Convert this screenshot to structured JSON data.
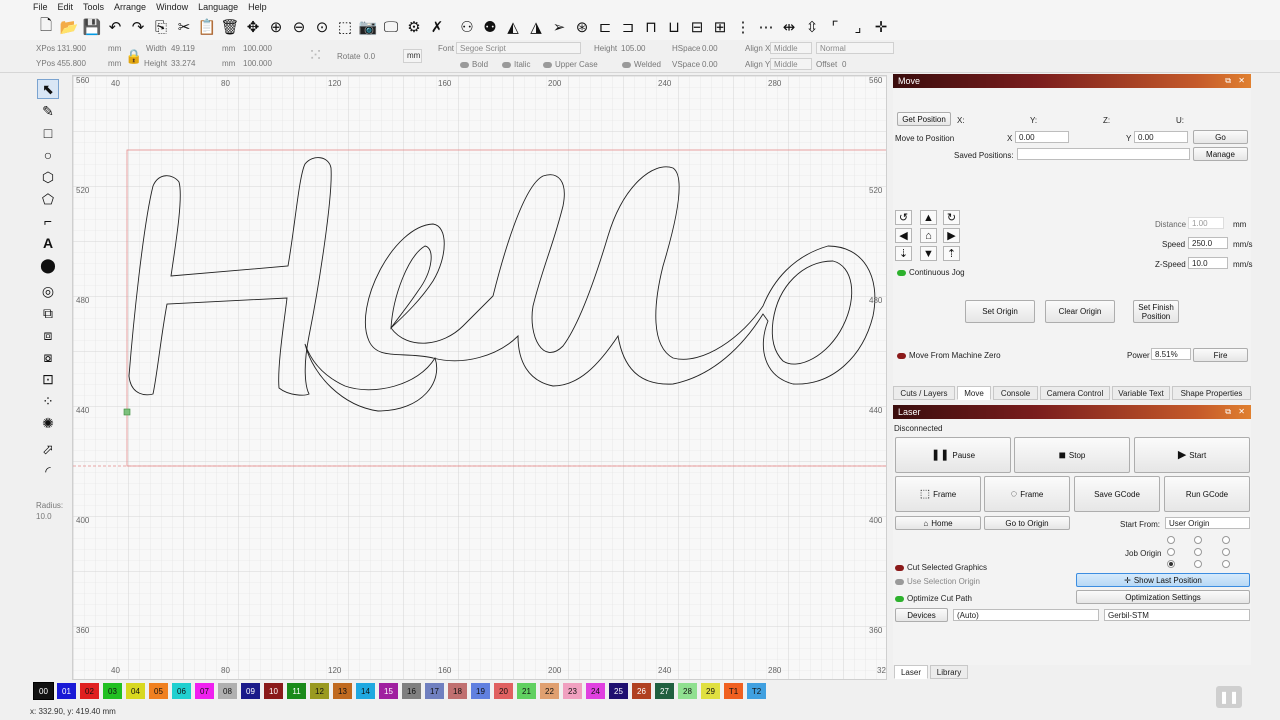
{
  "menu": [
    "File",
    "Edit",
    "Tools",
    "Arrange",
    "Window",
    "Language",
    "Help"
  ],
  "props": {
    "xpos_label": "XPos",
    "xpos": "131.900",
    "ypos_label": "YPos",
    "ypos": "455.800",
    "unit": "mm",
    "width_label": "Width",
    "width": "49.119",
    "height_label": "Height",
    "height": "33.274",
    "pct_w": "100.000",
    "pct_h": "100.000",
    "rotate_label": "Rotate",
    "rotate": "0.0",
    "mm_btn": "mm",
    "font_label": "Font",
    "font": "Segoe Script",
    "fheight_label": "Height",
    "fheight": "105.00",
    "hspace_label": "HSpace",
    "hspace": "0.00",
    "vspace_label": "VSpace",
    "vspace": "0.00",
    "alignx_label": "Align X",
    "alignx": "Middle",
    "aligny_label": "Align Y",
    "aligny": "Middle",
    "normal": "Normal",
    "offset_label": "Offset",
    "offset": "0",
    "bold": "Bold",
    "italic": "Italic",
    "upper": "Upper Case",
    "welded": "Welded"
  },
  "palette": {
    "radius_label": "Radius:",
    "radius": "10.0"
  },
  "ruler": {
    "x": [
      "40",
      "80",
      "120",
      "160",
      "200",
      "240",
      "280"
    ],
    "x_bottom": [
      "40",
      "80",
      "120",
      "160",
      "200",
      "240",
      "280",
      "32"
    ],
    "y": [
      "560",
      "520",
      "480",
      "440",
      "400",
      "360"
    ],
    "y_right": [
      "560",
      "520",
      "480",
      "440",
      "400",
      "360"
    ]
  },
  "colors": [
    {
      "label": "00",
      "color": "#111111"
    },
    {
      "label": "01",
      "color": "#1a1ad6"
    },
    {
      "label": "02",
      "color": "#e02020"
    },
    {
      "label": "03",
      "color": "#22c022"
    },
    {
      "label": "04",
      "color": "#d8d820"
    },
    {
      "label": "05",
      "color": "#f08020"
    },
    {
      "label": "06",
      "color": "#20d0d0"
    },
    {
      "label": "07",
      "color": "#f020f0"
    },
    {
      "label": "08",
      "color": "#b0b0b0"
    },
    {
      "label": "09",
      "color": "#1a1a8a"
    },
    {
      "label": "10",
      "color": "#8a1a1a"
    },
    {
      "label": "11",
      "color": "#1a8a1a"
    },
    {
      "label": "12",
      "color": "#9a9a20"
    },
    {
      "label": "13",
      "color": "#c06a20"
    },
    {
      "label": "14",
      "color": "#20a8e0"
    },
    {
      "label": "15",
      "color": "#a020a0"
    },
    {
      "label": "16",
      "color": "#808080"
    },
    {
      "label": "17",
      "color": "#7080c0"
    },
    {
      "label": "18",
      "color": "#c07070"
    },
    {
      "label": "19",
      "color": "#6080e0"
    },
    {
      "label": "20",
      "color": "#e06060"
    },
    {
      "label": "21",
      "color": "#60d060"
    },
    {
      "label": "22",
      "color": "#e0a070"
    },
    {
      "label": "23",
      "color": "#f0a0c0"
    },
    {
      "label": "24",
      "color": "#e040e0"
    },
    {
      "label": "25",
      "color": "#201070"
    },
    {
      "label": "26",
      "color": "#b04020"
    },
    {
      "label": "27",
      "color": "#206040"
    },
    {
      "label": "28",
      "color": "#90e090"
    },
    {
      "label": "29",
      "color": "#e0e040"
    },
    {
      "label": "T1",
      "color": "#f06020"
    },
    {
      "label": "T2",
      "color": "#40a0e0"
    }
  ],
  "status": "x: 332.90, y: 419.40 mm",
  "move_panel": {
    "title": "Move",
    "get_position": "Get Position",
    "x_lbl": "X:",
    "y_lbl": "Y:",
    "z_lbl": "Z:",
    "u_lbl": "U:",
    "move_to": "Move to Position",
    "mx_lbl": "X",
    "mx": "0.00",
    "my_lbl": "Y",
    "my": "0.00",
    "go": "Go",
    "saved_positions": "Saved Positions:",
    "manage": "Manage",
    "distance_lbl": "Distance",
    "distance": "1.00",
    "distance_unit": "mm",
    "speed_lbl": "Speed",
    "speed": "250.0",
    "speed_unit": "mm/s",
    "zspeed_lbl": "Z-Speed",
    "zspeed": "10.0",
    "zspeed_unit": "mm/s",
    "continuous_jog": "Continuous Jog",
    "set_origin": "Set Origin",
    "clear_origin": "Clear Origin",
    "set_finish": "Set Finish Position",
    "move_from_zero": "Move From Machine Zero",
    "power_lbl": "Power",
    "power": "8.51%",
    "fire": "Fire"
  },
  "tabs": [
    "Cuts / Layers",
    "Move",
    "Console",
    "Camera Control",
    "Variable Text",
    "Shape Properties"
  ],
  "laser_panel": {
    "title": "Laser",
    "status": "Disconnected",
    "pause": "Pause",
    "stop": "Stop",
    "start": "Start",
    "frame1": "Frame",
    "frame2": "Frame",
    "save_gcode": "Save GCode",
    "run_gcode": "Run GCode",
    "home": "Home",
    "go_to_origin": "Go to Origin",
    "start_from_lbl": "Start From:",
    "start_from": "User Origin",
    "job_origin": "Job Origin",
    "cut_selected": "Cut Selected Graphics",
    "use_selection": "Use Selection Origin",
    "optimize": "Optimize Cut Path",
    "show_last": "Show Last Position",
    "opt_settings": "Optimization Settings",
    "devices": "Devices",
    "auto": "(Auto)",
    "device": "Gerbil-STM"
  },
  "bottom_tabs": [
    "Laser",
    "Library"
  ]
}
